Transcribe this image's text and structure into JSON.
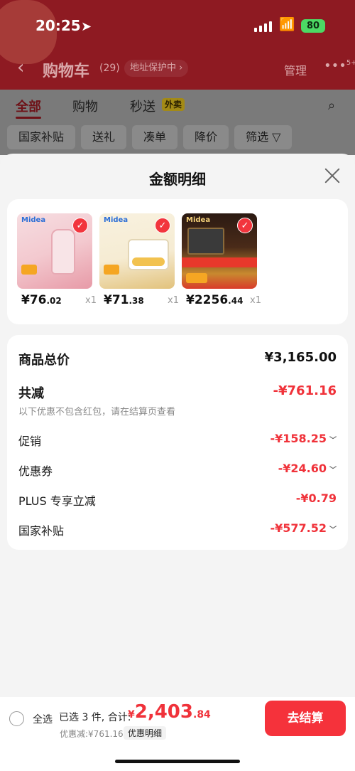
{
  "status_bar": {
    "time": "20:25",
    "battery": "80"
  },
  "header": {
    "back_icon": "chevron-left-icon",
    "title": "购物车",
    "count": "(29)",
    "address_protect": "地址保护中 ›",
    "manage": "管理",
    "more_badge": "5+"
  },
  "tabs": [
    {
      "label": "全部"
    },
    {
      "label": "购物"
    },
    {
      "label": "秒送"
    }
  ],
  "tab_badge": "外卖",
  "chips": [
    "国家补贴",
    "送礼",
    "凑单",
    "降价",
    "筛选 ▽"
  ],
  "sheet": {
    "title": "金额明细"
  },
  "products": [
    {
      "brand": "Midea",
      "price_int": "¥76",
      "price_dec": ".02",
      "qty": "x1",
      "colors": [
        "#f3c9cf",
        "#e79aa7"
      ]
    },
    {
      "brand": "Midea",
      "price_int": "¥71",
      "price_dec": ".38",
      "qty": "x1",
      "colors": [
        "#f6ecd3",
        "#e2c27c"
      ]
    },
    {
      "brand": "Midea",
      "price_int": "¥2256",
      "price_dec": ".44",
      "qty": "x1",
      "colors": [
        "#4a2b19",
        "#c8892f"
      ]
    }
  ],
  "details": {
    "goods_total_label": "商品总价",
    "goods_total_value": "¥3,165.00",
    "reduce_label": "共减",
    "reduce_value": "-¥761.16",
    "note": "以下优惠不包含红包，请在结算页查看",
    "items": [
      {
        "label": "促销",
        "value": "-¥158.25",
        "chevron": true
      },
      {
        "label": "优惠券",
        "value": "-¥24.60",
        "chevron": true
      },
      {
        "label": "PLUS 专享立减",
        "value": "-¥0.79",
        "chevron": false
      },
      {
        "label": "国家补贴",
        "value": "-¥577.52",
        "chevron": true
      }
    ]
  },
  "bottom": {
    "select_all": "全选",
    "selected_text": "已选 3 件, 合计:",
    "total_currency": "¥",
    "total_int": "2,403",
    "total_dec": ".84",
    "saved": "优惠减:¥761.16",
    "detail_link": "优惠明细",
    "checkout": "去结算"
  }
}
